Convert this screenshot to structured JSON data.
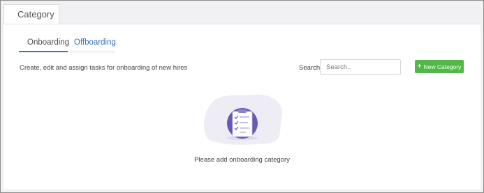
{
  "window": {
    "tab_title": "Category"
  },
  "tabs": [
    {
      "label": "Onboarding",
      "active": true
    },
    {
      "label": "Offboarding",
      "active": false
    }
  ],
  "description": "Create, edit and assign tasks for onboarding of new hires",
  "search": {
    "label": "Search",
    "placeholder": "Search..",
    "value": ""
  },
  "new_category_button": {
    "label": "New Category",
    "icon": "plus-icon"
  },
  "empty_state": {
    "icon": "clipboard-checklist-icon",
    "message": "Please add onboarding category"
  },
  "colors": {
    "accent_blue": "#2e7ab7",
    "button_green": "#51b847",
    "illustration_purple": "#6758b3",
    "illustration_blob": "#eeedf6"
  }
}
